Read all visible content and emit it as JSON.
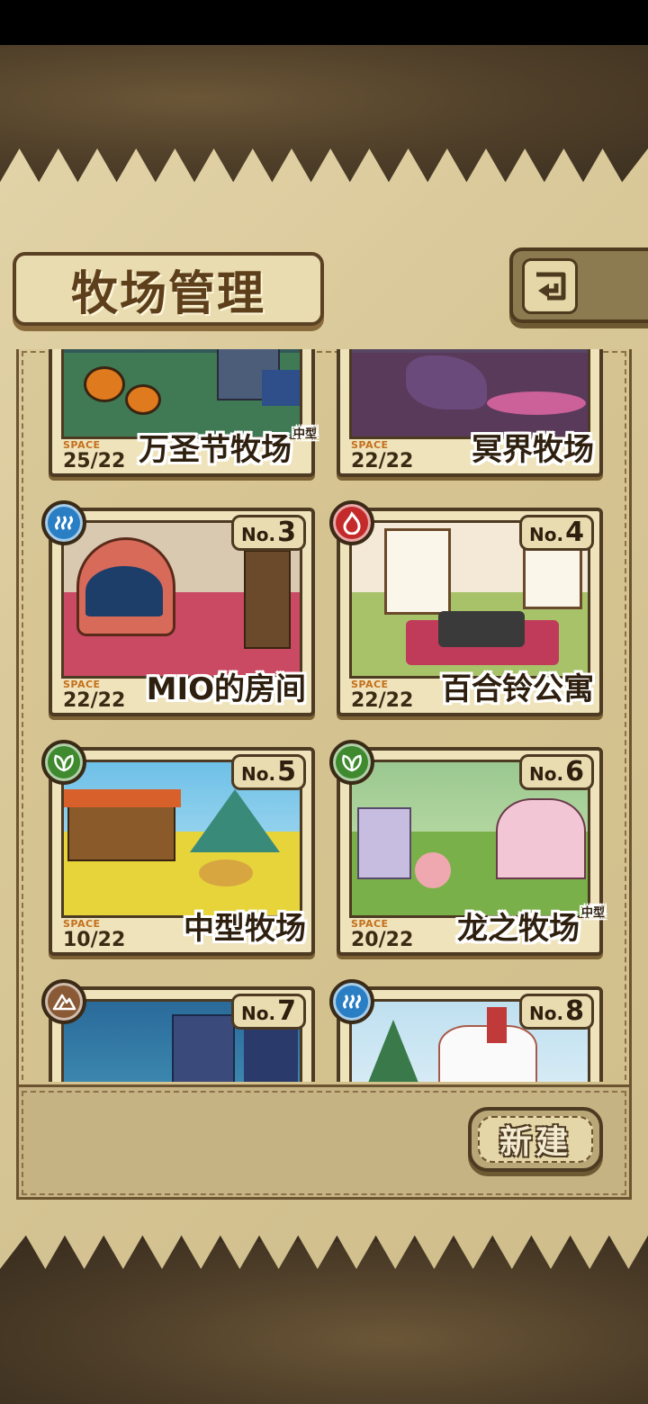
{
  "header": {
    "title": "牧场管理",
    "back_icon": "return-arrow-icon"
  },
  "space_label": "SPACE",
  "no_prefix": "No.",
  "ranches": [
    {
      "name": "万圣节牧场",
      "size_tag": "中型",
      "space": "25/22",
      "number": "",
      "element": ""
    },
    {
      "name": "冥界牧场",
      "size_tag": "",
      "space": "22/22",
      "number": "",
      "element": ""
    },
    {
      "name": "MIO的房间",
      "size_tag": "",
      "space": "22/22",
      "number": "3",
      "element": "water-icon",
      "element_color": "#2a7fc4"
    },
    {
      "name": "百合铃公寓",
      "size_tag": "",
      "space": "22/22",
      "number": "4",
      "element": "fire-icon",
      "element_color": "#c42a2a"
    },
    {
      "name": "中型牧场",
      "size_tag": "",
      "space": "10/22",
      "number": "5",
      "element": "leaf-icon",
      "element_color": "#3f8a2e"
    },
    {
      "name": "龙之牧场",
      "size_tag": "中型",
      "space": "20/22",
      "number": "6",
      "element": "leaf-icon",
      "element_color": "#3f8a2e"
    },
    {
      "name": "",
      "size_tag": "",
      "space": "",
      "number": "7",
      "element": "earth-icon",
      "element_color": "#8a5a36"
    },
    {
      "name": "",
      "size_tag": "",
      "space": "",
      "number": "8",
      "element": "water-icon",
      "element_color": "#2a7fc4"
    }
  ],
  "footer": {
    "new_label": "新建"
  },
  "colors": {
    "parchment": "#d8c797",
    "frame": "#4d3a22",
    "accent_orange": "#c46f1c"
  }
}
